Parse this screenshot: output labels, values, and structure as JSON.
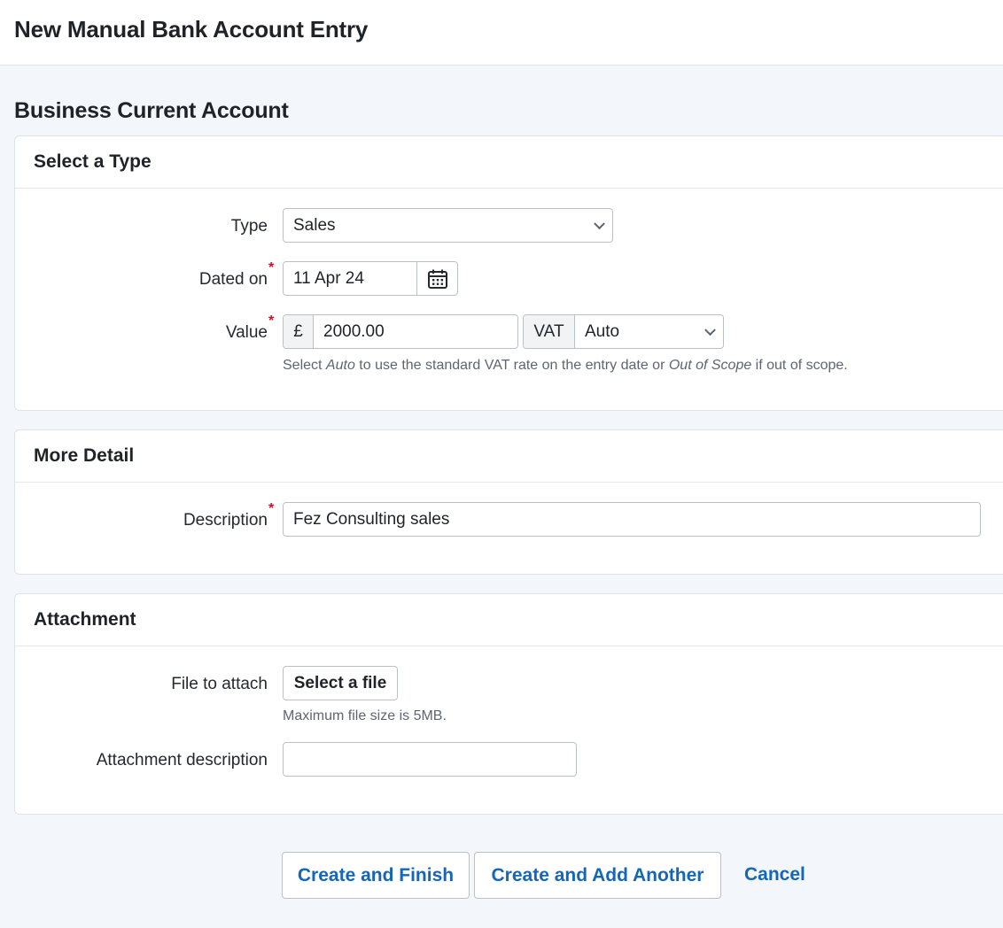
{
  "header": {
    "title": "New Manual Bank Account Entry"
  },
  "account": {
    "name": "Business Current Account"
  },
  "type_section": {
    "title": "Select a Type",
    "type_label": "Type",
    "type_value": "Sales",
    "date_label": "Dated on",
    "date_value": "11 Apr 24",
    "value_label": "Value",
    "currency_symbol": "£",
    "value_amount": "2000.00",
    "vat_label": "VAT",
    "vat_value": "Auto",
    "help_prefix": "Select ",
    "help_auto": "Auto",
    "help_middle": " to use the standard VAT rate on the entry date or ",
    "help_scope": "Out of Scope",
    "help_suffix": " if out of scope."
  },
  "detail_section": {
    "title": "More Detail",
    "description_label": "Description",
    "description_value": "Fez Consulting sales"
  },
  "attachment_section": {
    "title": "Attachment",
    "file_label": "File to attach",
    "file_button": "Select a file",
    "file_help": "Maximum file size is 5MB.",
    "attachment_desc_label": "Attachment description",
    "attachment_desc_value": ""
  },
  "actions": {
    "create_finish": "Create and Finish",
    "create_another": "Create and Add Another",
    "cancel": "Cancel"
  },
  "required_marker": "*",
  "colors": {
    "link": "#1466b8",
    "required": "#c8102e",
    "background": "#f3f6fb"
  }
}
